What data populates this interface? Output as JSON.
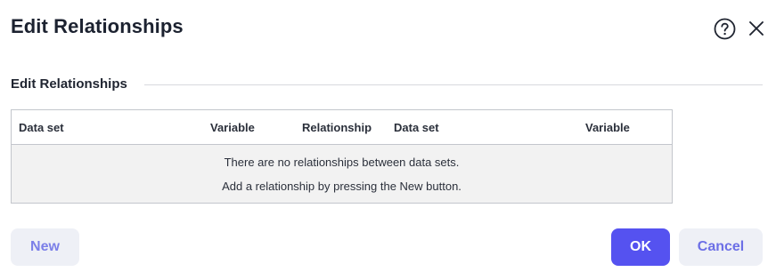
{
  "dialog": {
    "title": "Edit Relationships",
    "help_icon": "question-circle-icon",
    "close_icon": "close-x-icon"
  },
  "section": {
    "title": "Edit Relationships"
  },
  "table": {
    "columns": [
      "Data set",
      "Variable",
      "Relationship",
      "Data set",
      "Variable"
    ],
    "empty_message_1": "There are no relationships between data sets.",
    "empty_message_2": "Add a relationship by pressing the New button."
  },
  "buttons": {
    "new_label": "New",
    "ok_label": "OK",
    "cancel_label": "Cancel"
  },
  "colors": {
    "primary": "#5552f0",
    "secondary_bg": "#eef0f6",
    "secondary_text": "#6c6fe6",
    "table_empty_bg": "#f2f2f2"
  }
}
